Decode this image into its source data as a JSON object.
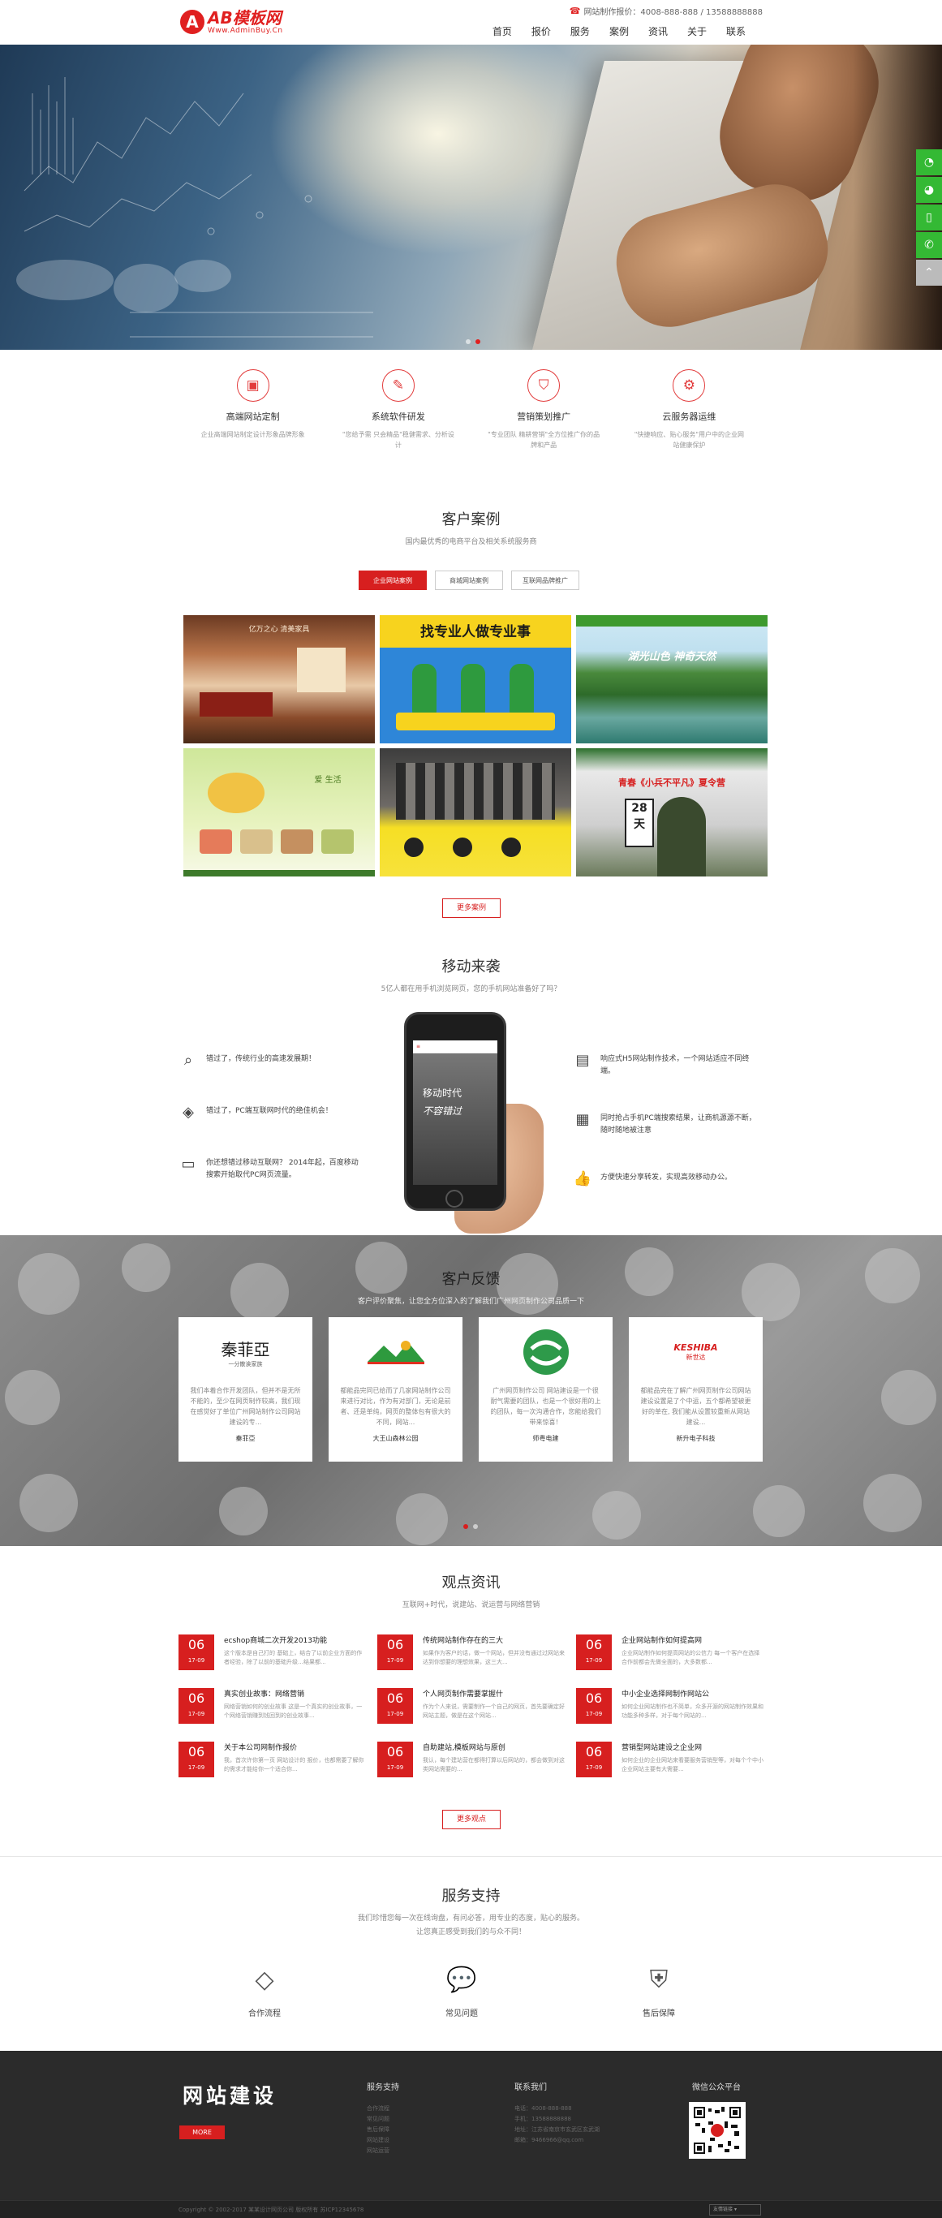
{
  "header": {
    "logo_text": "AB模板网",
    "logo_sub": "Www.AdminBuy.Cn",
    "hotline": "网站制作报价：4008-888-888 / 13588888888",
    "nav": [
      "首页",
      "报价",
      "服务",
      "案例",
      "资讯",
      "关于",
      "联系"
    ]
  },
  "services": [
    {
      "icon": "website-icon",
      "title": "高端网站定制",
      "desc": "企业高端网站制定设计形象品牌形象"
    },
    {
      "icon": "pen-icon",
      "title": "系统软件研发",
      "desc": "\"您给予需 只会精品\"稳健需求、分析设计"
    },
    {
      "icon": "bag-icon",
      "title": "营销策划推广",
      "desc": "\"专业团队 精耕营销\"全方位推广你的品牌和产品"
    },
    {
      "icon": "gear-icon",
      "title": "云服务器运维",
      "desc": "\"快捷响应、贴心服务\"用户中的企业网站健康保护"
    }
  ],
  "cases": {
    "title": "客户案例",
    "subtitle": "国内最优秀的电商平台及相关系统服务商",
    "tabs": [
      "企业网站案例",
      "商城网站案例",
      "互联网品牌推广"
    ],
    "items": [
      {
        "name": "case-interior",
        "text": "亿万之心 清美家具"
      },
      {
        "name": "case-pro",
        "text": "找专业人做专业事"
      },
      {
        "name": "case-lake",
        "text": "湖光山色 神奇天然"
      },
      {
        "name": "case-tea",
        "text": "爱 生活"
      },
      {
        "name": "case-store",
        "text": ""
      },
      {
        "name": "case-soldier",
        "text": "青春《小兵不平凡》夏令营"
      }
    ],
    "more": "更多案例"
  },
  "mobile": {
    "title": "移动来袭",
    "subtitle": "5亿人都在用手机浏览网页，您的手机网站准备好了吗？",
    "left": [
      {
        "icon": "search-icon",
        "text": "错过了，传统行业的高速发展期！"
      },
      {
        "icon": "diamond-icon",
        "text": "错过了，PC端互联网时代的绝佳机会！"
      },
      {
        "icon": "chat-icon",
        "text": "你还想错过移动互联网？ 2014年起，百度移动搜索开始取代PC网页流量。"
      }
    ],
    "right": [
      {
        "icon": "browser-icon",
        "text": "响应式H5网站制作技术，一个网站适应不同终端。"
      },
      {
        "icon": "window-icon",
        "text": "同时抢占手机PC端搜索结果，让商机源源不断，随时随地被注意"
      },
      {
        "icon": "thumb-icon",
        "text": "方便快速分享转发，实现高效移动办公。"
      }
    ],
    "screen_line1": "移动时代",
    "screen_line2": "不容错过"
  },
  "feedback": {
    "title": "客户反馈",
    "subtitle": "客户评价聚焦，让您全方位深入的了解我们广州网页制作公司品质一下",
    "cards": [
      {
        "logo": "秦菲亞",
        "logo_sub": "一分散诶家族",
        "text": "我们本着合作开发团队，但并不是无所不能的，至少在网页制作较高，我们现在感觉好了单位广州网站制作公司网站建设的专...",
        "name": "秦菲亞"
      },
      {
        "logo": "大王山",
        "logo_sub": "",
        "text": "都能品完同已给而了几家网站制作公司来进行对比，作为有对部门，无论是前者、还是单纯，网页的整体包有很大的不同，网站...",
        "name": "大王山森林公园"
      },
      {
        "logo": "",
        "logo_sub": "",
        "text": "广州网页制作公司 网站建设是一个很耐气需要的团队，也是一个很好用的上的团队，每一次沟通合作，您能给我们带来惊喜！",
        "name": "师粤电建"
      },
      {
        "logo": "KESHIBA",
        "logo_sub": "新世达",
        "text": "都能品完在了解广州网页制作公司网站建设设置是了个中运，五个都希望被更好的单在, 我们能从设置较重新从网站建设...",
        "name": "新升电子科技"
      }
    ]
  },
  "news": {
    "title": "观点资讯",
    "subtitle": "互联网+时代，说建站、说运营与网络营销",
    "items": [
      {
        "day": "06",
        "mon": "17-09",
        "title": "ecshop商城二次开发2013功能",
        "desc": "这个版本是自己打的 基础上，结合了以前企业方面的作者经验，除了以前的基础升级…结果都..."
      },
      {
        "day": "06",
        "mon": "17-09",
        "title": "传统网站制作存在的三大",
        "desc": "如果作为客户的话，做一个网站，但并没有通过过网站来达到你想要的理想效果，这三大..."
      },
      {
        "day": "06",
        "mon": "17-09",
        "title": "企业网站制作如何提高网",
        "desc": "企业网站制作如何提高网站的公信力 每一个客户在选择合作前都会先做全面的，大多数都..."
      },
      {
        "day": "06",
        "mon": "17-09",
        "title": "真实创业故事：网络营销",
        "desc": "网络营销如何的创业故事 这是一个真实的创业故事，一个网络营销赚到钱回到的创业故事..."
      },
      {
        "day": "06",
        "mon": "17-09",
        "title": "个人网页制作需要掌握什",
        "desc": "作为个人来说，需要制作一个自己的网页，首先要确定好网站主题，做是在这个网站..."
      },
      {
        "day": "06",
        "mon": "17-09",
        "title": "中小企业选择网制作网站公",
        "desc": "如何企业网站制作也不简单，众多开源的网站制作效果和功能多种多样，对于每个网站的..."
      },
      {
        "day": "06",
        "mon": "17-09",
        "title": "关于本公司网制作报价",
        "desc": "我，首次许你第一页 网站设计的 报价，也都需要了解你的需求才能给你一个适合你..."
      },
      {
        "day": "06",
        "mon": "17-09",
        "title": "自助建站,模板网站与原创",
        "desc": "我认，每个建站营在都得打算以后网站的，都会做到对这类网站需要的... "
      },
      {
        "day": "06",
        "mon": "17-09",
        "title": "营销型网站建设之企业网",
        "desc": "如何企业的企业网站来看要服务营销型等，对每个个中小企业网站主要有大需要..."
      }
    ],
    "more": "更多观点"
  },
  "support": {
    "title": "服务支持",
    "subtitle1": "我们珍惜您每一次在线询盘，有问必答，用专业的态度，贴心的服务。",
    "subtitle2": "让您真正感受到我们的与众不同！",
    "items": [
      {
        "icon": "handshake-icon",
        "label": "合作流程"
      },
      {
        "icon": "question-icon",
        "label": "常见问题"
      },
      {
        "icon": "shield-icon",
        "label": "售后保障"
      }
    ]
  },
  "footer": {
    "slogan": "网站建设",
    "more": "MORE",
    "col1_title": "服务支持",
    "col1_items": [
      "合作流程",
      "常见问题",
      "售后保障",
      "网站建设",
      "网站运营"
    ],
    "col2_title": "联系我们",
    "col2_items": [
      "电话：4008-888-888",
      "手机：13588888888",
      "地址：江苏省南京市玄武区玄武湖",
      "邮箱：9466966@qq.com"
    ],
    "col3_title": "微信公众平台",
    "copyright": "Copyright © 2002-2017 某某设计网页公司 版权所有 苏ICP12345678",
    "lang": "友情链接"
  },
  "colors": {
    "accent": "#d71f1f",
    "footer_bg": "#2b2b2b",
    "float_green": "#34b934"
  }
}
